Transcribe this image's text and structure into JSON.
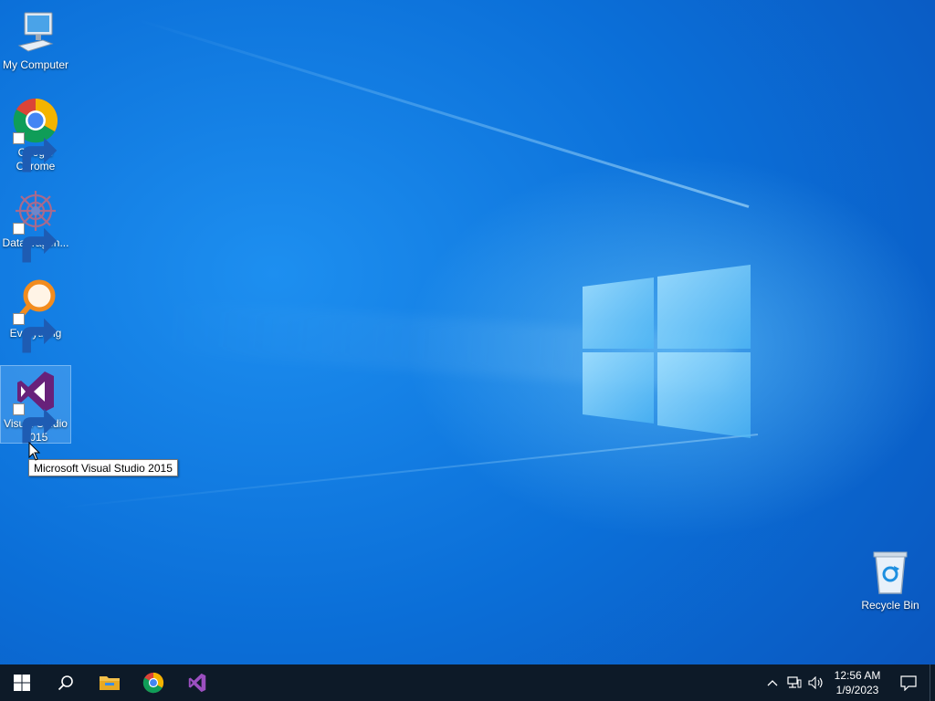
{
  "desktop": {
    "icons": [
      {
        "label": "My Computer",
        "icon": "computer-icon"
      },
      {
        "label": "Google Chrome",
        "icon": "chrome-icon",
        "shortcut": true
      },
      {
        "label": "DataWagon...",
        "icon": "datawagon-icon",
        "shortcut": true
      },
      {
        "label": "Everything",
        "icon": "everything-search-icon",
        "shortcut": true
      },
      {
        "label": "Visual Studio 2015",
        "icon": "visual-studio-icon",
        "shortcut": true,
        "selected": true
      },
      {
        "label": "Recycle Bin",
        "icon": "recycle-bin-icon"
      }
    ],
    "tooltip": "Microsoft Visual Studio 2015"
  },
  "taskbar": {
    "buttons": [
      {
        "name": "start",
        "icon": "windows-start-icon"
      },
      {
        "name": "search",
        "icon": "search-icon"
      },
      {
        "name": "file-explorer",
        "icon": "folder-icon"
      },
      {
        "name": "google-chrome",
        "icon": "chrome-icon"
      },
      {
        "name": "visual-studio",
        "icon": "visual-studio-icon"
      }
    ],
    "tray": {
      "icons": [
        "chevron-up-icon",
        "network-icon",
        "volume-icon"
      ],
      "time": "12:56 AM",
      "date": "1/9/2023",
      "action_center_icon": "notification-icon"
    }
  },
  "colors": {
    "taskbar": "#0d1a28",
    "desktop_blue": "#0b6fd8",
    "vs_purple": "#68217a",
    "accent": "#76b9ed"
  }
}
